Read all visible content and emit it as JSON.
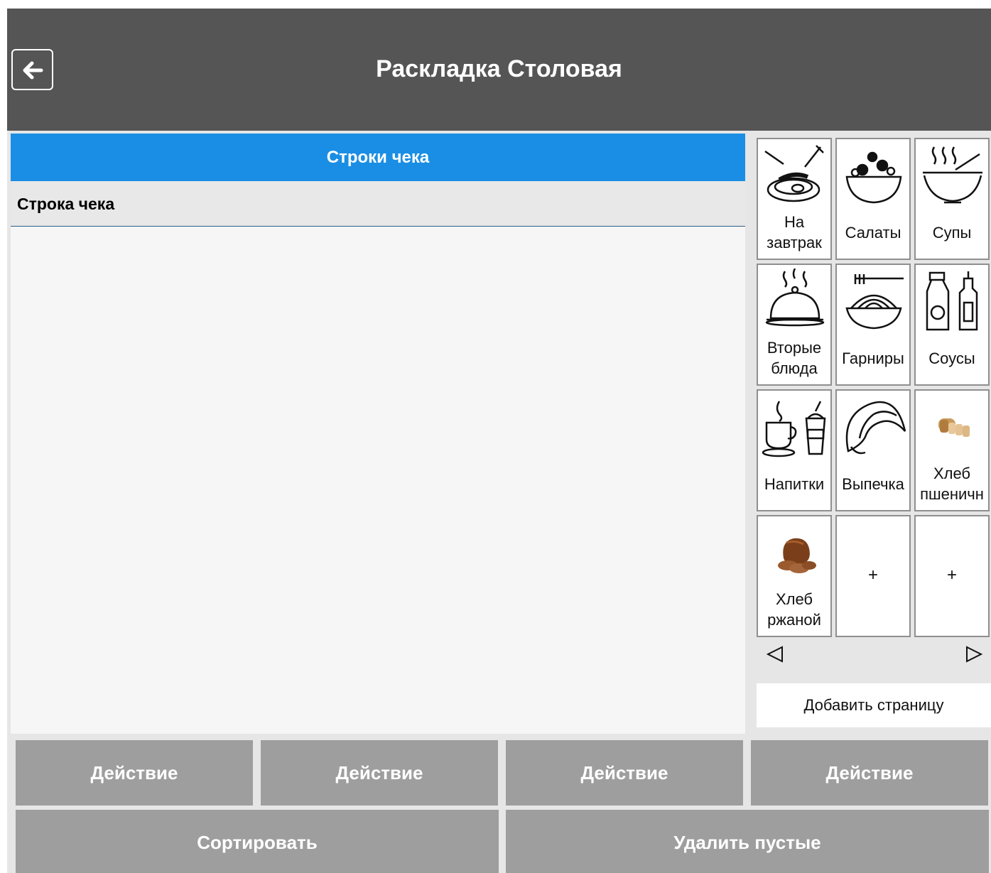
{
  "header": {
    "title": "Раскладка Столовая",
    "back_icon": "arrow-left-icon"
  },
  "receipt": {
    "panel_title": "Строки чека",
    "column_header": "Строка чека"
  },
  "grid": {
    "tiles": [
      {
        "label": "На завтрак",
        "icon": "breakfast-icon"
      },
      {
        "label": "Салаты",
        "icon": "salad-bowl-icon"
      },
      {
        "label": "Супы",
        "icon": "soup-bowl-icon"
      },
      {
        "label": "Вторые блюда",
        "icon": "cloche-icon"
      },
      {
        "label": "Гарниры",
        "icon": "pasta-bowl-icon"
      },
      {
        "label": "Соусы",
        "icon": "sauce-bottles-icon"
      },
      {
        "label": "Напитки",
        "icon": "drinks-icon"
      },
      {
        "label": "Выпечка",
        "icon": "croissant-icon"
      },
      {
        "label": "Хлеб пшеничн",
        "icon": "wheat-bread-icon"
      },
      {
        "label": "Хлеб ржаной",
        "icon": "rye-bread-icon"
      },
      {
        "label": "+",
        "icon": ""
      },
      {
        "label": "+",
        "icon": ""
      }
    ],
    "prev_icon": "triangle-left-icon",
    "next_icon": "triangle-right-icon",
    "add_page": "Добавить страницу"
  },
  "actions": {
    "buttons": [
      "Действие",
      "Действие",
      "Действие",
      "Действие"
    ],
    "sort": "Сортировать",
    "delete_empty": "Удалить пустые"
  },
  "colors": {
    "header_bg": "#555555",
    "accent": "#1a8ee4",
    "button_bg": "#9e9e9e",
    "panel_bg": "#f6f6f6"
  }
}
